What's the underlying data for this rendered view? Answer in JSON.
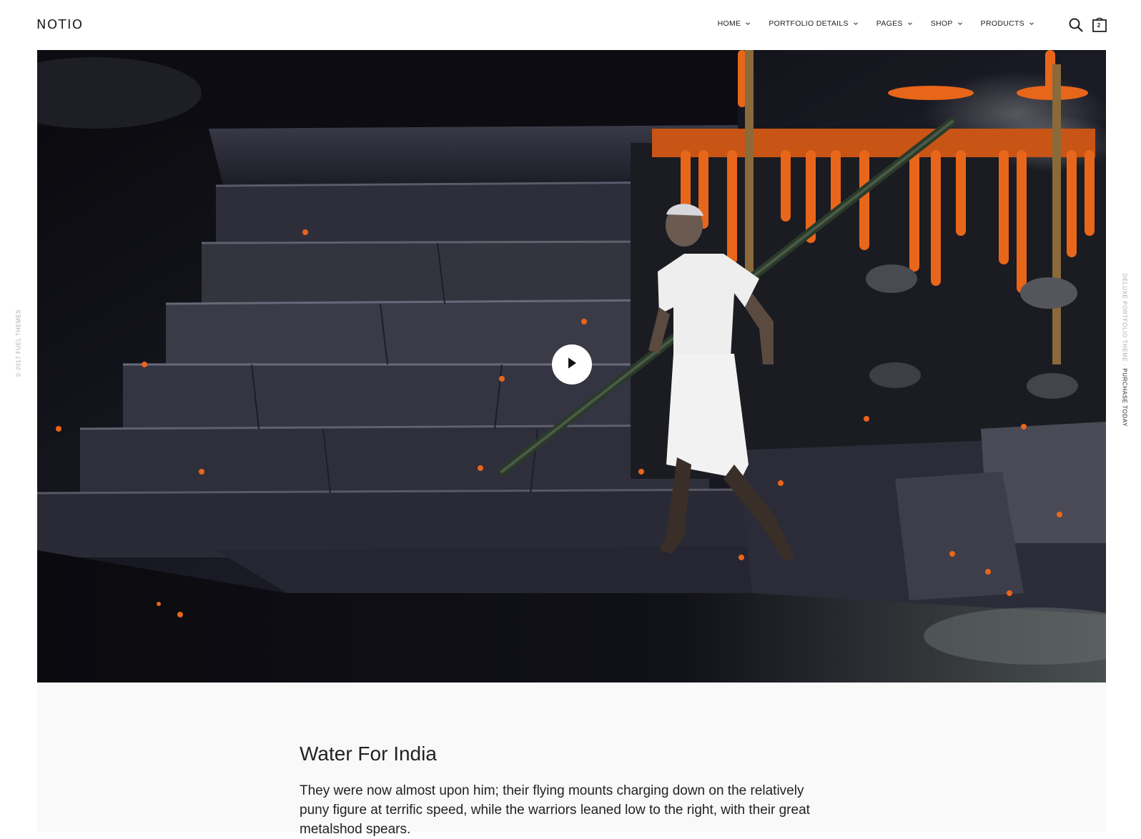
{
  "header": {
    "logo": "NOTIO",
    "nav": [
      {
        "label": "HOME"
      },
      {
        "label": "PORTFOLIO DETAILS"
      },
      {
        "label": "PAGES"
      },
      {
        "label": "SHOP"
      },
      {
        "label": "PRODUCTS"
      }
    ],
    "cart_count": "2",
    "icons": [
      "search-icon",
      "cart-icon",
      "chevron-down-icon"
    ]
  },
  "hero": {
    "media": "video",
    "play_icon": "play-icon"
  },
  "side": {
    "left_text": "© 2017 FUEL THEMES",
    "right_text_muted": "DELUXE PORTFOLIO THEME · ",
    "right_text_link": "PURCHASE TODAY"
  },
  "post": {
    "title": "Water For India",
    "body": "They were now almost upon him; their flying mounts charging down on the relatively puny figure at terrific speed, while the warriors leaned low to the right, with their great metalshod spears."
  },
  "colors": {
    "background": "#ffffff",
    "content_bg": "#f9f9f9",
    "text": "#222222",
    "marigold": "#e8661a"
  }
}
